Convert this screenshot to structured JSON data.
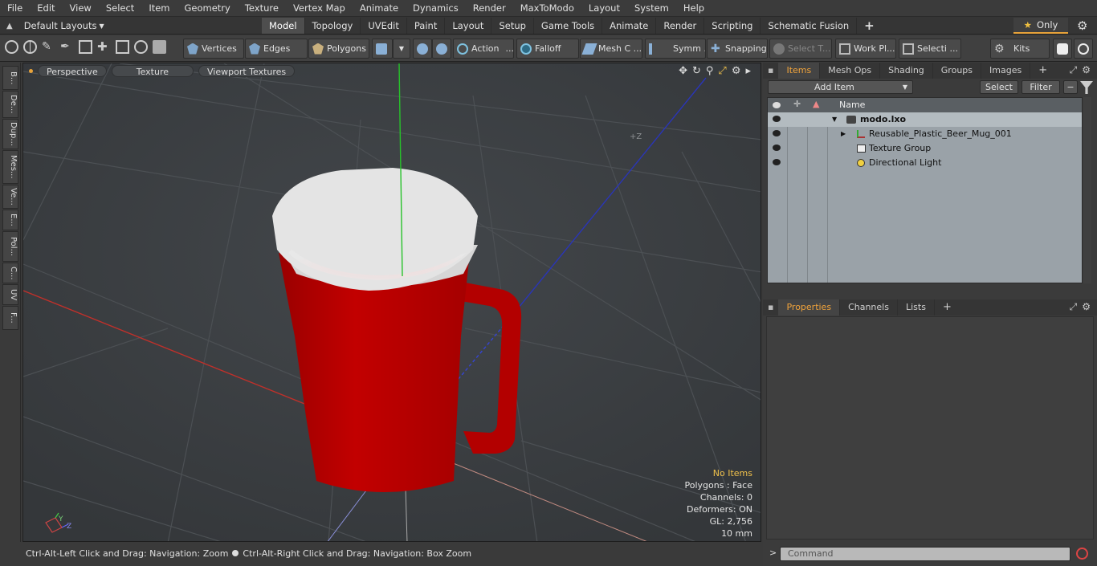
{
  "menu": [
    "File",
    "Edit",
    "View",
    "Select",
    "Item",
    "Geometry",
    "Texture",
    "Vertex Map",
    "Animate",
    "Dynamics",
    "Render",
    "MaxToModo",
    "Layout",
    "System",
    "Help"
  ],
  "layout_selector": "Default Layouts",
  "mode_tabs": [
    "Model",
    "Topology",
    "UVEdit",
    "Paint",
    "Layout",
    "Setup",
    "Game Tools",
    "Animate",
    "Render",
    "Scripting",
    "Schematic Fusion"
  ],
  "only_button": "Only",
  "toolbar": {
    "vertices": "Vertices",
    "edges": "Edges",
    "polygons": "Polygons",
    "action": "Action",
    "falloff": "Falloff",
    "mesh": "Mesh C ...",
    "symmetry": "Symm ...",
    "snapping": "Snapping",
    "select_t": "Select T...",
    "work_plane": "Work Pl...",
    "selection": "Selecti ...",
    "kits": "Kits"
  },
  "left_tabs": [
    "B...",
    "De...",
    "Dup...",
    "Mes...",
    "Ve...",
    "E...",
    "Pol...",
    "C...",
    "UV",
    "F..."
  ],
  "viewport": {
    "buttons": [
      "Perspective",
      "Texture",
      "Viewport Textures"
    ],
    "axis_label": "+Z",
    "stats": {
      "no_items": "No Items",
      "polygons": "Polygons : Face",
      "channels": "Channels: 0",
      "deformers": "Deformers: ON",
      "gl": "GL: 2,756",
      "size": "10 mm"
    },
    "gizmo": {
      "y": "Y",
      "z": "Z"
    }
  },
  "status": {
    "left": "Ctrl-Alt-Left Click and Drag: Navigation: Zoom",
    "right": "Ctrl-Alt-Right Click and Drag: Navigation: Box Zoom"
  },
  "items_panel": {
    "tabs": [
      "Items",
      "Mesh Ops",
      "Shading",
      "Groups",
      "Images"
    ],
    "add_item": "Add Item",
    "select": "Select",
    "filter": "Filter",
    "column_name": "Name",
    "rows": [
      "modo.lxo",
      "Reusable_Plastic_Beer_Mug_001",
      "Texture Group",
      "Directional Light"
    ]
  },
  "properties_panel": {
    "tabs": [
      "Properties",
      "Channels",
      "Lists"
    ]
  },
  "command_placeholder": "Command",
  "colors": {
    "accent": "#f0a33b",
    "mug_red": "#b40000",
    "mug_rim": "#e6e6e6"
  }
}
